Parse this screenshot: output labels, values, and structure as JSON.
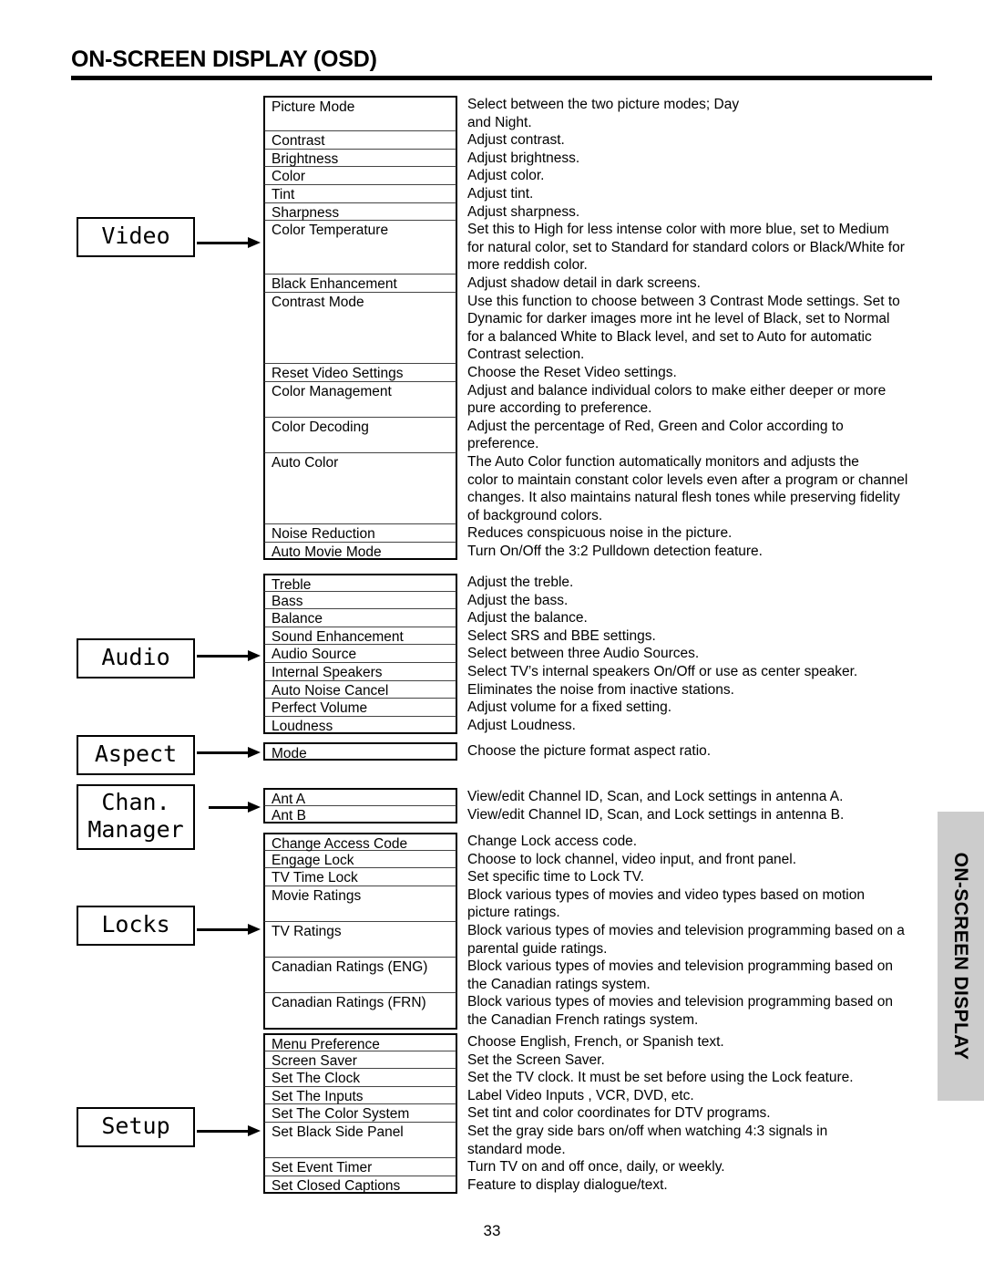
{
  "header": {
    "title": "ON-SCREEN DISPLAY (OSD)"
  },
  "side_tab": {
    "label": "ON-SCREEN DISPLAY",
    "background": "#cccccc"
  },
  "page_number": "33",
  "categories": [
    {
      "label": "Video",
      "name": "category-video"
    },
    {
      "label": "Audio",
      "name": "category-audio"
    },
    {
      "label": "Aspect",
      "name": "category-aspect"
    },
    {
      "label": "Chan.\nManager",
      "name": "category-chan-manager"
    },
    {
      "label": "Locks",
      "name": "category-locks"
    },
    {
      "label": "Setup",
      "name": "category-setup"
    }
  ],
  "groups": [
    {
      "id": "video",
      "rows": [
        {
          "name": "Picture Mode",
          "desc": "Select between the two picture modes; Day\nand Night.",
          "lines": 2
        },
        {
          "name": "Contrast",
          "desc": "Adjust contrast.",
          "lines": 1
        },
        {
          "name": "Brightness",
          "desc": "Adjust brightness.",
          "lines": 1
        },
        {
          "name": "Color",
          "desc": "Adjust color.",
          "lines": 1
        },
        {
          "name": "Tint",
          "desc": "Adjust tint.",
          "lines": 1
        },
        {
          "name": "Sharpness",
          "desc": "Adjust sharpness.",
          "lines": 1
        },
        {
          "name": "Color Temperature",
          "desc": "Set this to High for less intense color with more blue, set to Medium\nfor natural color, set to Standard for standard colors or Black/White for\nmore reddish color.",
          "lines": 3
        },
        {
          "name": "Black Enhancement",
          "desc": "Adjust shadow detail in dark screens.",
          "lines": 1
        },
        {
          "name": "Contrast Mode",
          "desc": "Use this function to choose between 3 Contrast Mode settings.  Set to\nDynamic for darker images more int he level of Black, set to Normal\nfor a balanced White to Black level, and set to Auto for automatic\nContrast selection.",
          "lines": 4
        },
        {
          "name": "Reset Video Settings",
          "desc": "Choose the Reset Video settings.",
          "lines": 1
        },
        {
          "name": "Color Management",
          "desc": "Adjust and balance individual colors to make either deeper or more\npure according to preference.",
          "lines": 2
        },
        {
          "name": "Color Decoding",
          "desc": "Adjust the percentage of Red, Green and Color according to\npreference.",
          "lines": 2
        },
        {
          "name": "Auto Color",
          "desc": "The Auto Color function automatically monitors and adjusts the\ncolor to maintain constant color levels even after a program or channel\nchanges. It also maintains natural flesh tones while preserving fidelity\nof background colors.",
          "lines": 4
        },
        {
          "name": "Noise Reduction",
          "desc": "Reduces conspicuous noise in the picture.",
          "lines": 1
        },
        {
          "name": "Auto Movie Mode",
          "desc": "Turn On/Off the 3:2 Pulldown detection feature.",
          "lines": 1
        }
      ]
    },
    {
      "id": "audio",
      "rows": [
        {
          "name": "Treble",
          "desc": "Adjust the treble.",
          "lines": 1
        },
        {
          "name": "Bass",
          "desc": "Adjust the bass.",
          "lines": 1
        },
        {
          "name": "Balance",
          "desc": "Adjust the balance.",
          "lines": 1
        },
        {
          "name": "Sound Enhancement",
          "desc": "Select SRS and BBE settings.",
          "lines": 1
        },
        {
          "name": "Audio Source",
          "desc": "Select between three Audio Sources.",
          "lines": 1
        },
        {
          "name": "Internal Speakers",
          "desc": "Select TV’s internal speakers On/Off or use as center speaker.",
          "lines": 1
        },
        {
          "name": "Auto Noise Cancel",
          "desc": "Eliminates the noise from inactive stations.",
          "lines": 1
        },
        {
          "name": "Perfect Volume",
          "desc": "Adjust volume for a fixed setting.",
          "lines": 1
        },
        {
          "name": "Loudness",
          "desc": "Adjust Loudness.",
          "lines": 1
        }
      ]
    },
    {
      "id": "aspect",
      "rows": [
        {
          "name": "Mode",
          "desc": "Choose the picture format aspect ratio.",
          "lines": 1
        }
      ]
    },
    {
      "id": "chan-manager",
      "rows": [
        {
          "name": "Ant A",
          "desc": "View/edit Channel ID, Scan, and Lock settings in antenna A.",
          "lines": 1
        },
        {
          "name": "Ant B",
          "desc": "View/edit Channel ID, Scan, and Lock settings in antenna B.",
          "lines": 1
        }
      ]
    },
    {
      "id": "locks",
      "rows": [
        {
          "name": "Change Access Code",
          "desc": "Change Lock access code.",
          "lines": 1
        },
        {
          "name": "Engage Lock",
          "desc": "Choose to lock channel, video input, and front panel.",
          "lines": 1
        },
        {
          "name": "TV Time Lock",
          "desc": "Set specific time to Lock TV.",
          "lines": 1
        },
        {
          "name": "Movie Ratings",
          "desc": "Block various types of movies and video types based on motion\npicture ratings.",
          "lines": 2
        },
        {
          "name": "TV Ratings",
          "desc": "Block various types of movies and television programming based on a\nparental guide ratings.",
          "lines": 2
        },
        {
          "name": "Canadian Ratings (ENG)",
          "desc": "Block various types of movies and television programming based on\nthe Canadian ratings system.",
          "lines": 2
        },
        {
          "name": "Canadian Ratings (FRN)",
          "desc": "Block various types of movies and television programming based on\nthe Canadian French ratings system.",
          "lines": 2
        }
      ]
    },
    {
      "id": "setup",
      "rows": [
        {
          "name": "Menu Preference",
          "desc": "Choose English, French, or Spanish text.",
          "lines": 1
        },
        {
          "name": "Screen Saver",
          "desc": "Set the Screen Saver.",
          "lines": 1
        },
        {
          "name": "Set The Clock",
          "desc": "Set the TV clock.  It must be set before using the Lock feature.",
          "lines": 1
        },
        {
          "name": "Set The Inputs",
          "desc": "Label Video Inputs , VCR, DVD, etc.",
          "lines": 1
        },
        {
          "name": "Set The Color System",
          "desc": "Set tint and color coordinates for DTV programs.",
          "lines": 1
        },
        {
          "name": "Set Black Side Panel",
          "desc": "Set the gray side bars on/off when watching 4:3 signals in\nstandard mode.",
          "lines": 2
        },
        {
          "name": "Set Event Timer",
          "desc": "Turn TV on and off once, daily, or weekly.",
          "lines": 1
        },
        {
          "name": "Set Closed Captions",
          "desc": "Feature to display dialogue/text.",
          "lines": 1
        }
      ]
    }
  ]
}
